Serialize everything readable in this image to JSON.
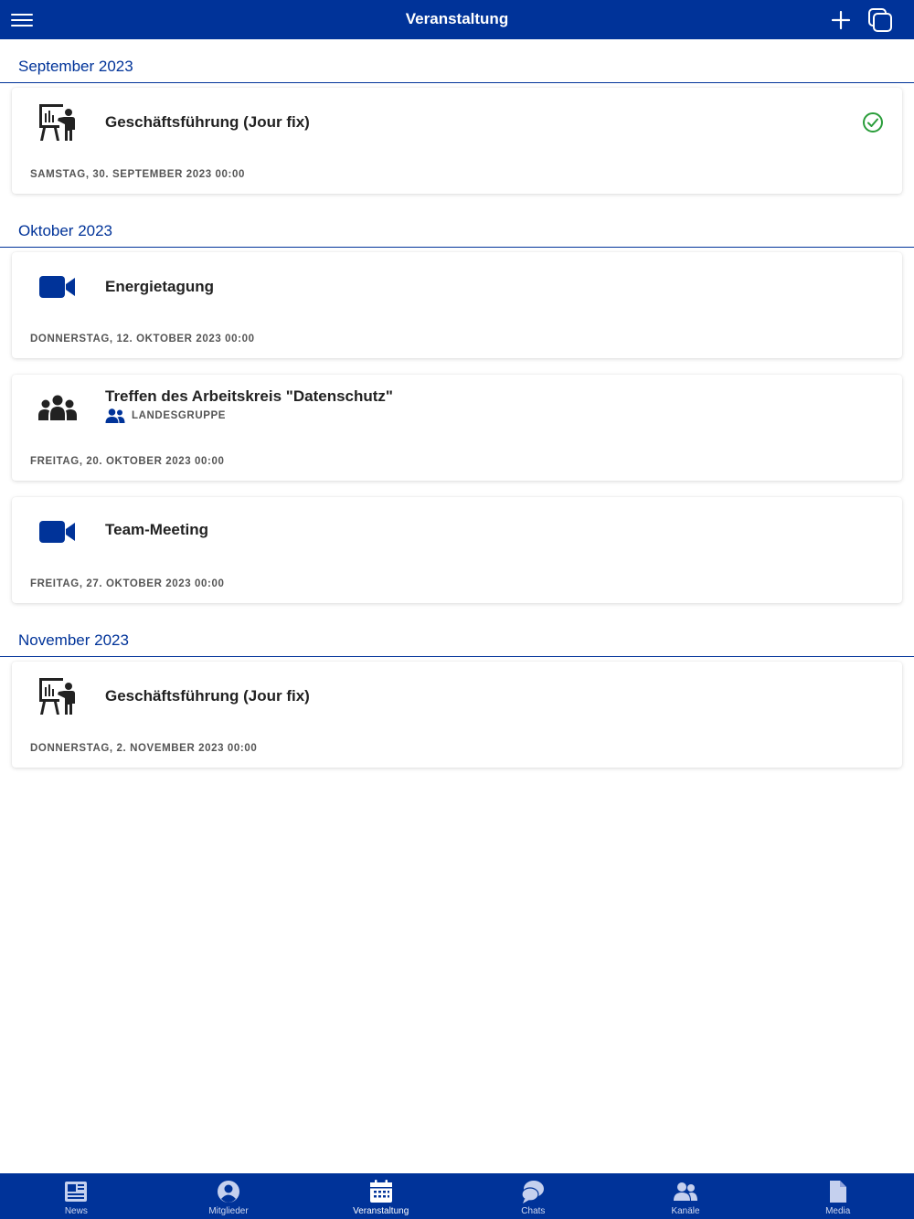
{
  "header": {
    "title": "Veranstaltung",
    "background_color": "#003399",
    "menu_icon": "hamburger-menu-icon",
    "add_icon": "plus-icon",
    "copy_icon": "copy-windows-icon"
  },
  "sections": [
    {
      "label": "September 2023",
      "events": [
        {
          "title": "Geschäftsführung (Jour fix)",
          "date": "SAMSTAG, 30. SEPTEMBER 2023 00:00",
          "icon": "presentation-icon",
          "status_icon": "check-circle-icon",
          "status_color": "#2a9d3a"
        }
      ]
    },
    {
      "label": "Oktober 2023",
      "events": [
        {
          "title": "Energietagung",
          "date": "DONNERSTAG, 12. OKTOBER 2023 00:00",
          "icon": "video-camera-icon"
        },
        {
          "title": "Treffen des Arbeitskreis \"Datenschutz\"",
          "group": "LANDESGRUPPE",
          "group_icon": "user-group-icon",
          "date": "FREITAG, 20. OKTOBER 2023 00:00",
          "icon": "people-group-icon"
        },
        {
          "title": "Team-Meeting",
          "date": "FREITAG, 27. OKTOBER 2023 00:00",
          "icon": "video-camera-icon"
        }
      ]
    },
    {
      "label": "November 2023",
      "events": [
        {
          "title": "Geschäftsführung (Jour fix)",
          "date": "DONNERSTAG, 2. NOVEMBER 2023 00:00",
          "icon": "presentation-icon"
        }
      ]
    }
  ],
  "bottom_nav": {
    "active": "Veranstaltung",
    "items": [
      {
        "label": "News",
        "icon": "newspaper-icon"
      },
      {
        "label": "Mitglieder",
        "icon": "user-circle-icon"
      },
      {
        "label": "Veranstaltung",
        "icon": "calendar-icon"
      },
      {
        "label": "Chats",
        "icon": "chat-bubbles-icon"
      },
      {
        "label": "Kanäle",
        "icon": "users-icon"
      },
      {
        "label": "Media",
        "icon": "file-icon"
      }
    ]
  }
}
